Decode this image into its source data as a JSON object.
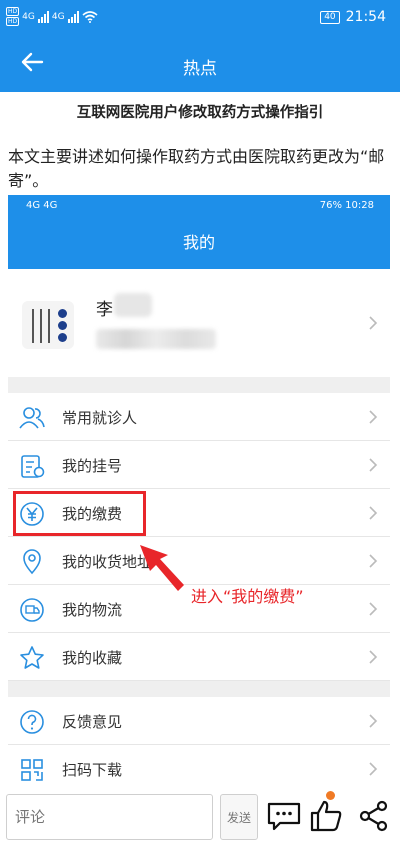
{
  "status_bar": {
    "network_1": "4G",
    "network_2": "4G",
    "battery": "40",
    "time": "21:54"
  },
  "header": {
    "title": "热点"
  },
  "article": {
    "title": "互联网医院用户修改取药方式操作指引",
    "intro": "本文主要讲述如何操作取药方式由医院取药更改为“邮寄”。"
  },
  "embedded": {
    "status": {
      "left": "4G 4G",
      "right": "76% 10:28"
    },
    "title": "我的",
    "profile": {
      "name": "李"
    },
    "menu_group_1": [
      {
        "label": "常用就诊人",
        "icon": "users-icon"
      },
      {
        "label": "我的挂号",
        "icon": "register-icon"
      },
      {
        "label": "我的缴费",
        "icon": "yuan-icon"
      },
      {
        "label": "我的收货地址",
        "icon": "location-icon"
      },
      {
        "label": "我的物流",
        "icon": "truck-icon"
      },
      {
        "label": "我的收藏",
        "icon": "star-icon"
      }
    ],
    "menu_group_2": [
      {
        "label": "反馈意见",
        "icon": "question-icon"
      },
      {
        "label": "扫码下载",
        "icon": "qr-icon"
      }
    ],
    "annotation": "进入“我的缴费”",
    "colors": {
      "primary": "#1e8fe9",
      "annotation": "#e8262a"
    }
  },
  "bottom_bar": {
    "comment_placeholder": "评论",
    "send_label": "发送"
  }
}
